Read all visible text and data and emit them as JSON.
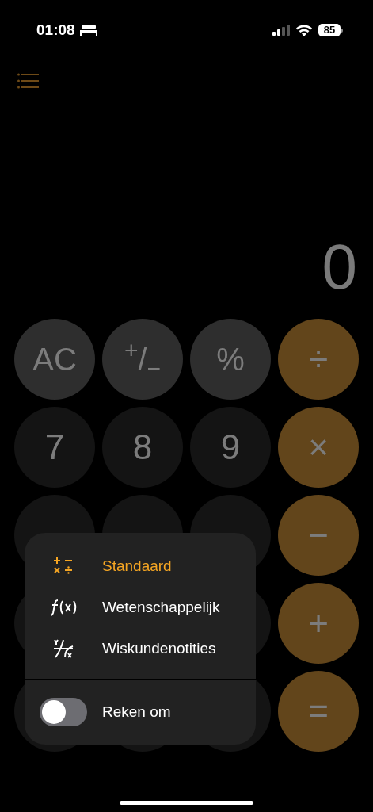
{
  "status_bar": {
    "time": "01:08",
    "battery": "85"
  },
  "display": {
    "value": "0"
  },
  "keypad": [
    {
      "kind": "func",
      "label": "AC"
    },
    {
      "kind": "func",
      "label": "$^{+}$/$_{−}$"
    },
    {
      "kind": "func",
      "label": "%"
    },
    {
      "kind": "op",
      "label": "÷"
    },
    {
      "kind": "digit",
      "label": "7"
    },
    {
      "kind": "digit",
      "label": "8"
    },
    {
      "kind": "digit",
      "label": "9"
    },
    {
      "kind": "op",
      "label": "×"
    },
    {
      "kind": "digit"
    },
    {
      "kind": "digit"
    },
    {
      "kind": "digit"
    },
    {
      "kind": "op",
      "label": "−"
    },
    {
      "kind": "digit"
    },
    {
      "kind": "gap"
    },
    {
      "kind": "digit"
    },
    {
      "kind": "op",
      "label": "+"
    },
    {
      "kind": "digit"
    },
    {
      "kind": "digit"
    },
    {
      "kind": "digit"
    },
    {
      "kind": "op",
      "label": "="
    }
  ],
  "menu": {
    "items": [
      {
        "kind": "operators",
        "label": "Standaard",
        "selected": true
      },
      {
        "kind": "function",
        "label": "Wetenschappelijk",
        "selected": false
      },
      {
        "kind": "notes",
        "label": "Wiskundenotities",
        "selected": false
      }
    ],
    "toggle": {
      "label": "Reken om",
      "on": false
    }
  }
}
